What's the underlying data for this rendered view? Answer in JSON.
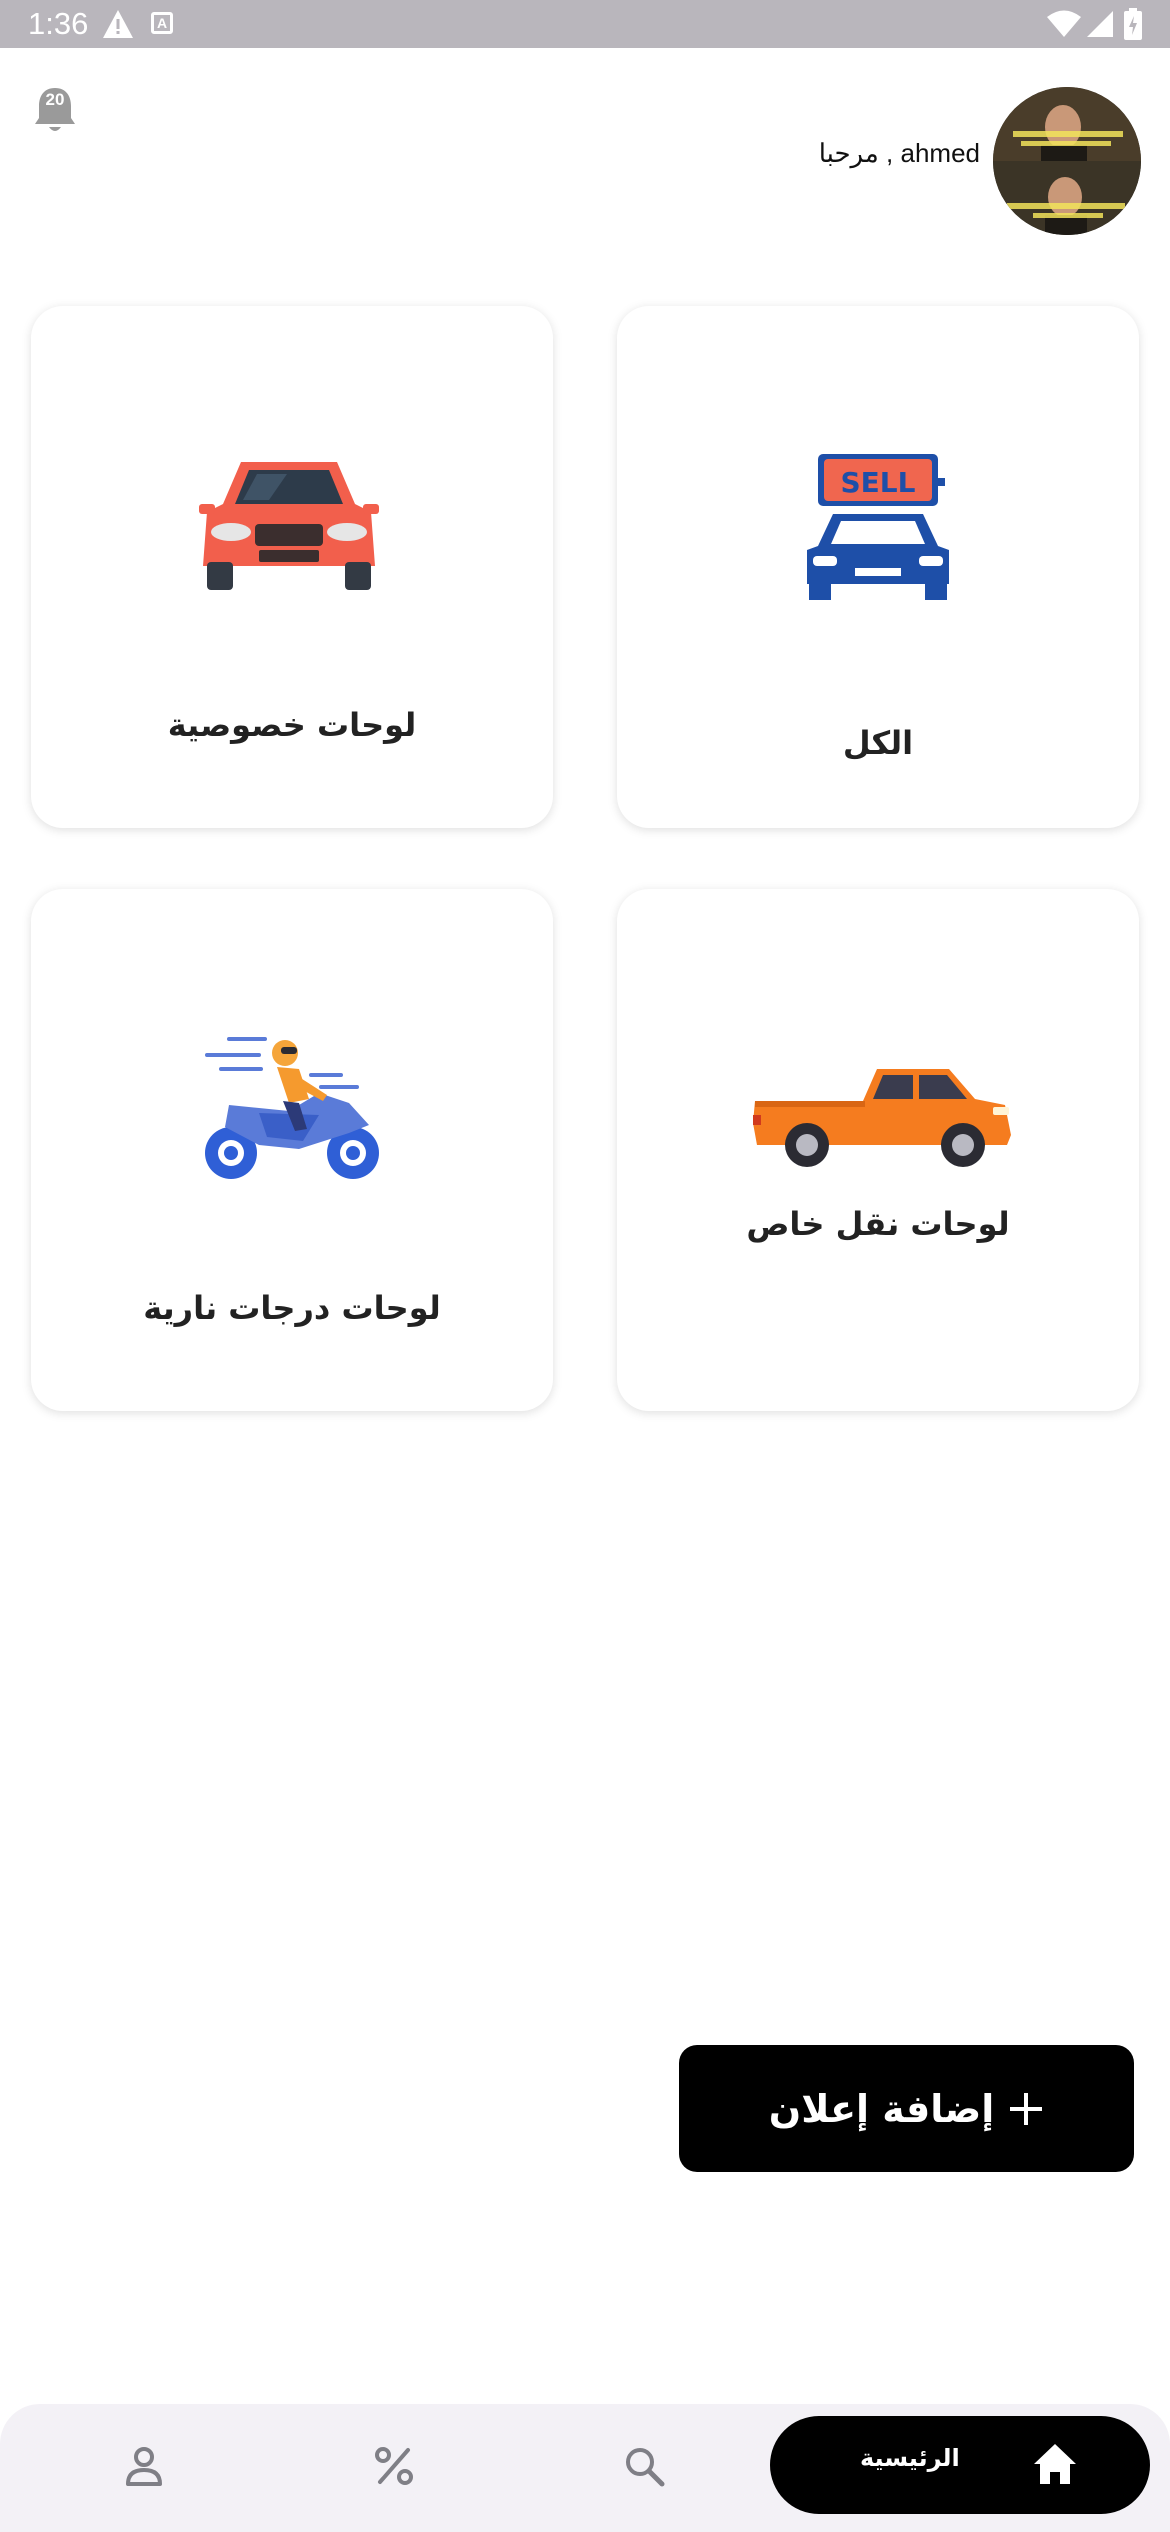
{
  "status_bar": {
    "time": "1:36",
    "a_glyph": "A"
  },
  "header": {
    "notification_count": "20",
    "greeting": "مرحبا , ahmed"
  },
  "categories": [
    {
      "label": "الكل",
      "icon": "sell-car-icon"
    },
    {
      "label": "لوحات خصوصية",
      "icon": "private-car-icon"
    },
    {
      "label": "لوحات نقل خاص",
      "icon": "pickup-truck-icon"
    },
    {
      "label": "لوحات درجات نارية",
      "icon": "motorcycle-icon"
    }
  ],
  "sell_sign_text": "SELL",
  "add_ad_button": {
    "label": "إضافة إعلان",
    "icon": "plus-icon"
  },
  "bottom_nav": {
    "home_label": "الرئيسية",
    "items": [
      "home-icon",
      "search-icon",
      "percent-icon",
      "profile-icon"
    ]
  },
  "colors": {
    "status_bar": "#b9b6bc",
    "button_bg": "#000000",
    "nav_bg": "#f3f1f6",
    "sell_car_blue": "#1e4fa8",
    "sell_sign": "#f0664f",
    "red_car": "#f25f4c",
    "pickup_orange": "#f57c1f"
  }
}
